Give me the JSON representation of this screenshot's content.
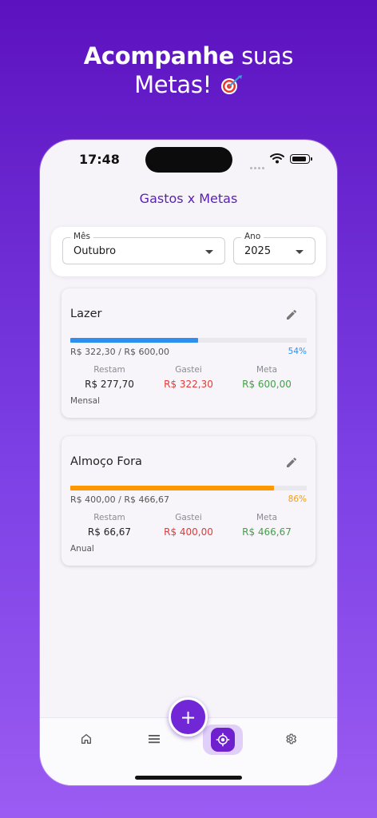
{
  "promo": {
    "bold": "Acompanhe",
    "rest": "suas",
    "line2": "Metas!"
  },
  "status_bar": {
    "time": "17:48"
  },
  "header": {
    "title": "Gastos x Metas"
  },
  "filters": {
    "month": {
      "label": "Mês",
      "value": "Outubro"
    },
    "year": {
      "label": "Ano",
      "value": "2025"
    }
  },
  "goals": [
    {
      "name": "Lazer",
      "ratio_text": "R$ 322,30 / R$ 600,00",
      "percent_text": "54%",
      "progress": 0.54,
      "bar_color": "#2f8fee",
      "percent_color": "#2f8fee",
      "stats": [
        {
          "label": "Restam",
          "value": "R$ 277,70",
          "color": "#222222"
        },
        {
          "label": "Gastei",
          "value": "R$ 322,30",
          "color": "#e53935"
        },
        {
          "label": "Meta",
          "value": "R$ 600,00",
          "color": "#43a047"
        }
      ],
      "period": "Mensal"
    },
    {
      "name": "Almoço Fora",
      "ratio_text": "R$ 400,00 / R$ 466,67",
      "percent_text": "86%",
      "progress": 0.86,
      "bar_color": "#ff9800",
      "percent_color": "#f39c12",
      "stats": [
        {
          "label": "Restam",
          "value": "R$ 66,67",
          "color": "#222222"
        },
        {
          "label": "Gastei",
          "value": "R$ 400,00",
          "color": "#e53935"
        },
        {
          "label": "Meta",
          "value": "R$ 466,67",
          "color": "#43a047"
        }
      ],
      "period": "Anual"
    }
  ],
  "nav": {
    "items": [
      {
        "icon": "home-icon"
      },
      {
        "icon": "menu-icon"
      },
      {
        "icon": "target-icon",
        "active": true
      },
      {
        "icon": "gear-icon"
      }
    ],
    "fab_symbol": "+"
  },
  "colors": {
    "accent": "#6f21cf",
    "title": "#5a1fb0"
  }
}
